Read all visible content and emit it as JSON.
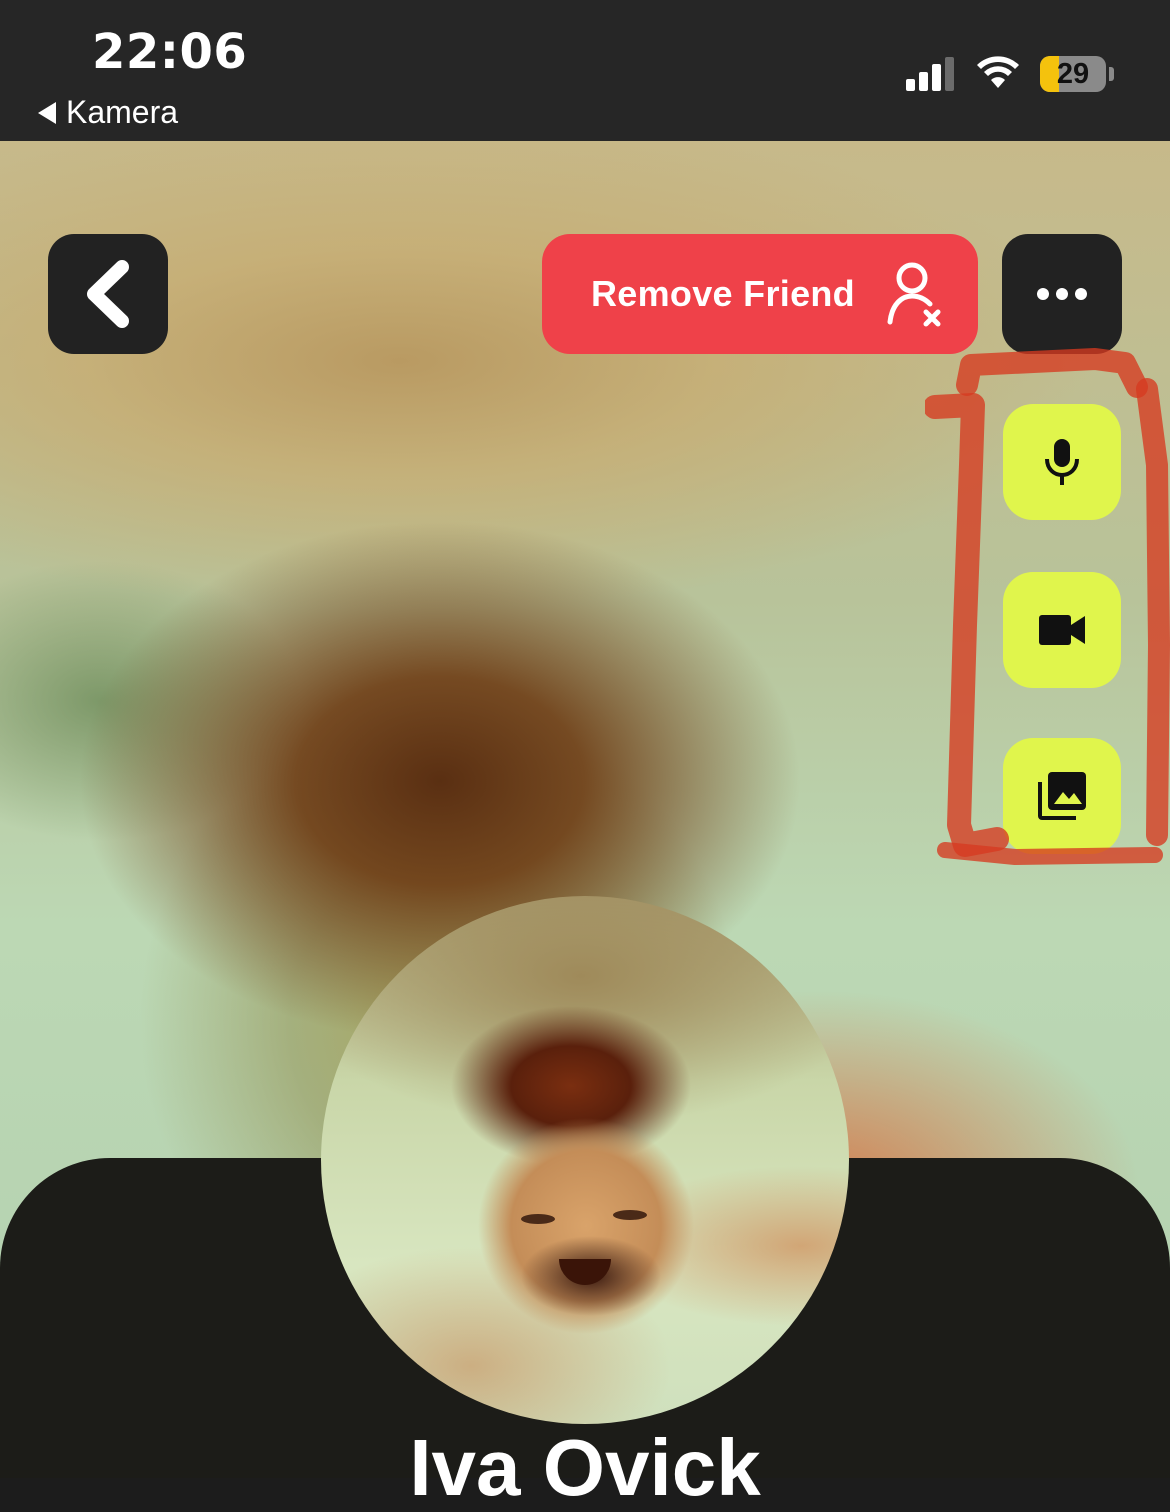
{
  "status_bar": {
    "time": "22:06",
    "back_app": "Kamera",
    "battery_level": "29",
    "battery_fraction": 0.29,
    "signal_bars": 3,
    "signal_max": 4
  },
  "header": {
    "back_icon": "chevron-left-icon",
    "remove_friend_label": "Remove Friend",
    "remove_friend_icon": "user-remove-icon",
    "more_icon": "more-horizontal-icon",
    "remove_color": "#ef4149"
  },
  "side_actions": [
    {
      "name": "voice-message-button",
      "icon": "microphone-icon"
    },
    {
      "name": "video-call-button",
      "icon": "video-camera-icon"
    },
    {
      "name": "gallery-button",
      "icon": "photo-library-icon"
    }
  ],
  "accent_color": "#e0f54c",
  "profile": {
    "name_partial": "Iva Ovick"
  }
}
